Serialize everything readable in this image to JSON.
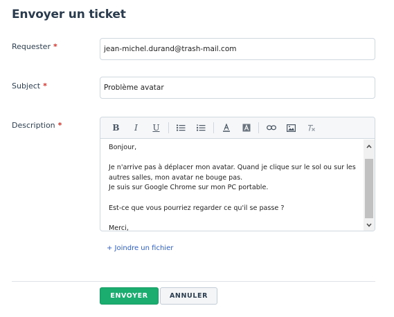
{
  "page": {
    "title": "Envoyer un ticket"
  },
  "form": {
    "requester": {
      "label": "Requester",
      "required_mark": "*",
      "value": "jean-michel.durand@trash-mail.com"
    },
    "subject": {
      "label": "Subject",
      "required_mark": "*",
      "value": "Problème avatar"
    },
    "description": {
      "label": "Description",
      "required_mark": "*",
      "toolbar": {
        "bold": "B",
        "italic": "I",
        "underline": "U",
        "bulleted_list": "bulleted-list-icon",
        "numbered_list": "numbered-list-icon",
        "font_color": "font-color-icon",
        "background_color": "background-color-icon",
        "link": "link-icon",
        "image": "image-icon",
        "clear_format": "clear-format-icon"
      },
      "lines": [
        " Bonjour,",
        "",
        "Je n'arrive pas à déplacer mon avatar. Quand je clique sur le sol ou sur les",
        "autres salles, mon avatar ne bouge pas.",
        "Je suis sur Google Chrome sur mon PC portable.",
        "",
        "Est-ce que vous pourriez regarder ce qu'il se passe ?",
        "",
        "Merci,"
      ]
    },
    "attach_link": "+ Joindre un fichier"
  },
  "actions": {
    "send_label": "ENVOYER",
    "cancel_label": "ANNULER"
  },
  "colors": {
    "primary_button": "#1bac70",
    "link": "#2c5cc5",
    "required": "#d0332b"
  }
}
